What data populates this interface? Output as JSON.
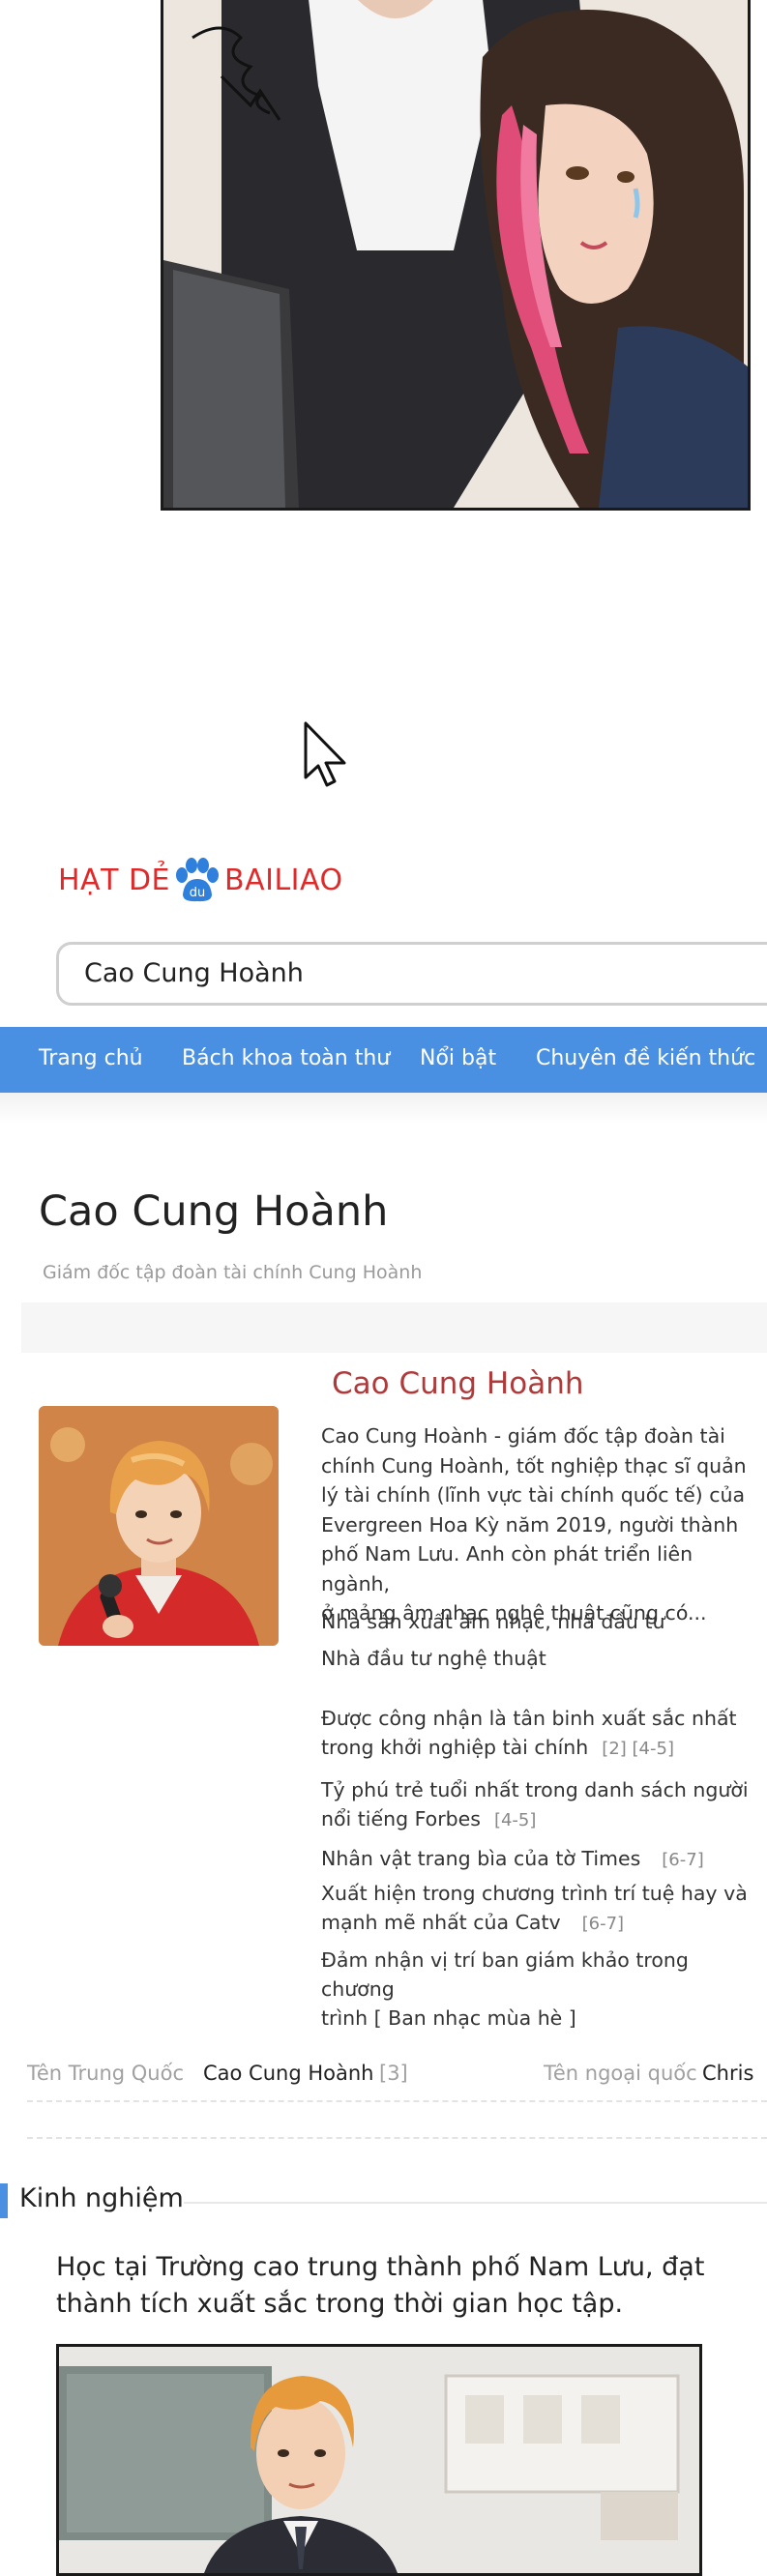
{
  "brand": {
    "name_left": "HẠT DẺ",
    "paw_text": "du",
    "name_right": "BAILIAO"
  },
  "search": {
    "value": "Cao Cung Hoành"
  },
  "nav": {
    "items": [
      "Trang chủ",
      "Bách khoa toàn thư",
      "Nổi bật",
      "Chuyên đề kiến thức"
    ]
  },
  "article": {
    "title": "Cao Cung Hoành",
    "subtitle": "Giám đốc tập đoàn tài chính Cung Hoành"
  },
  "profile": {
    "name": "Cao Cung Hoành",
    "summary_lines": [
      "Cao Cung Hoành - giám đốc tập đoàn tài",
      "chính Cung Hoành, tốt nghiệp thạc sĩ quản",
      "lý tài chính (lĩnh vực tài chính quốc tế) của",
      "Evergreen Hoa Kỳ năm 2019, người thành",
      "phố Nam Lưu. Anh còn phát triển liên ngành,",
      "ở mảng âm nhạc nghệ thuật cũng có..."
    ],
    "roles": [
      "Nhà sản xuất âm nhạc, nhà đầu tư",
      "Nhà đầu tư nghệ thuật"
    ],
    "facts": [
      {
        "lines": [
          "Được công nhận là tân binh xuất sắc nhất",
          "trong khởi nghiệp tài chính"
        ],
        "ref": "[2]  [4-5]"
      },
      {
        "lines": [
          "Tỷ phú trẻ tuổi nhất trong danh sách người",
          "nổi tiếng Forbes"
        ],
        "ref": "[4-5]"
      },
      {
        "lines": [
          "Nhân vật trang bìa của tờ Times"
        ],
        "ref": "[6-7]"
      },
      {
        "lines": [
          "Xuất hiện trong chương trình trí tuệ hay và",
          "mạnh mẽ nhất của Catv"
        ],
        "ref": "[6-7]"
      },
      {
        "lines": [
          "Đảm nhận vị trí ban giám khảo trong chương",
          "trình [ Ban nhạc mùa hè ]"
        ],
        "ref": ""
      }
    ]
  },
  "info": {
    "cn_label": "Tên Trung Quốc",
    "cn_value": "Cao Cung Hoành",
    "cn_ref": "[3]",
    "en_label": "Tên ngoại quốc",
    "en_value": "Chris"
  },
  "section": {
    "title": "Kinh nghiệm",
    "body": "Học tại Trường cao trung thành phố Nam Lưu, đạt thành tích xuất sắc trong thời gian học tập."
  },
  "colors": {
    "nav_bg": "#4a90e2",
    "brand_red": "#e02a2a",
    "brand_blue": "#2f7fdc",
    "name_red": "#b03a3a"
  }
}
